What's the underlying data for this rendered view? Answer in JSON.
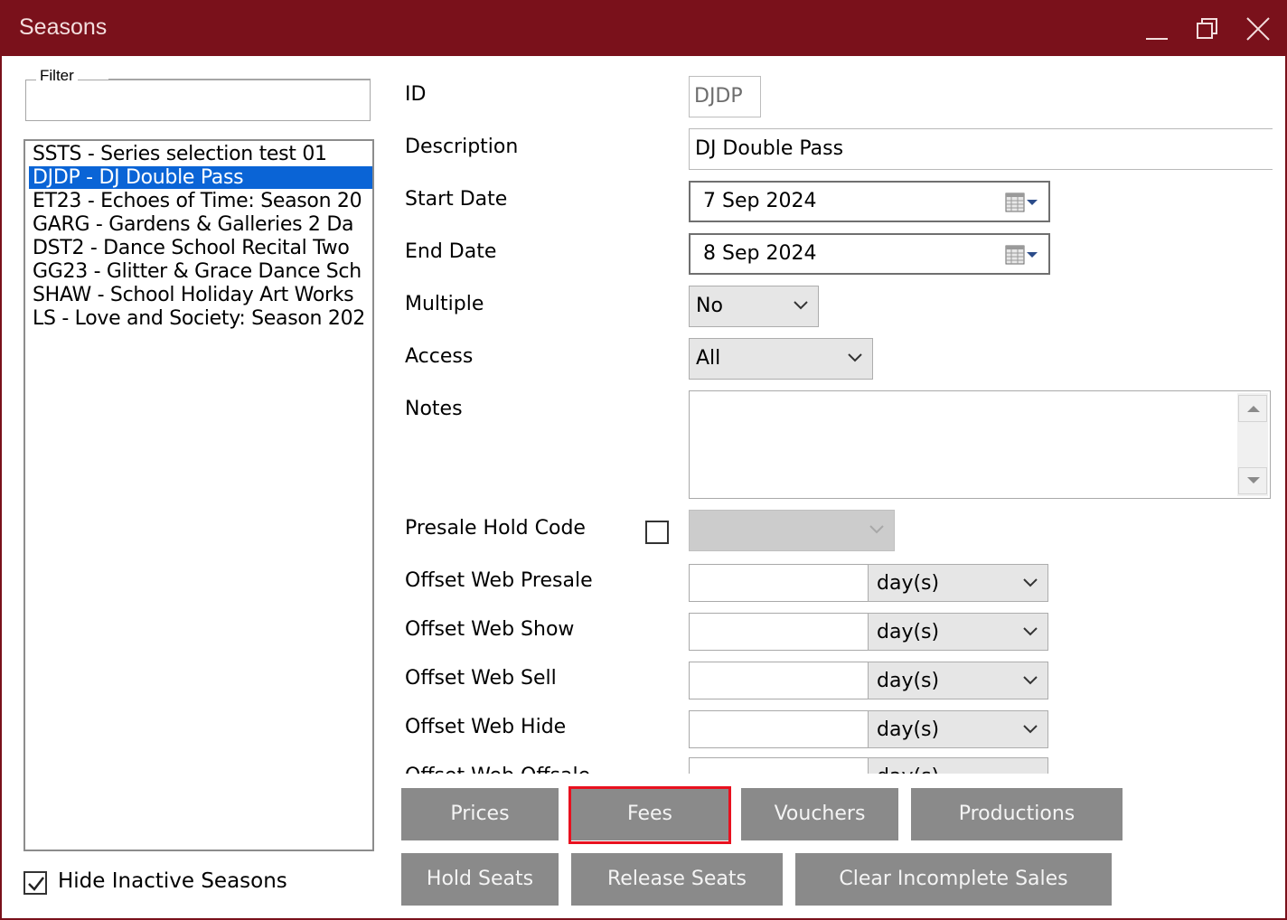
{
  "window": {
    "title": "Seasons"
  },
  "filter": {
    "label": "Filter",
    "value": ""
  },
  "seasons": [
    "SSTS - Series selection test 01",
    "DJDP - DJ Double Pass",
    "ET23 - Echoes of Time: Season 20",
    "GARG - Gardens & Galleries 2 Da",
    "DST2 - Dance School Recital Two",
    "GG23 - Glitter & Grace Dance Sch",
    "SHAW - School Holiday Art Works",
    "LS - Love and Society: Season 202"
  ],
  "selected_season": "DJDP - DJ Double Pass",
  "hide_inactive": {
    "label": "Hide Inactive Seasons",
    "checked": true
  },
  "form": {
    "id_label": "ID",
    "id_value": "DJDP",
    "description_label": "Description",
    "description_value": "DJ Double Pass",
    "start_label": "Start Date",
    "start_value": "7  Sep  2024",
    "end_label": "End Date",
    "end_value": "8  Sep  2024",
    "multiple_label": "Multiple",
    "multiple_value": "No",
    "access_label": "Access",
    "access_value": "All",
    "notes_label": "Notes",
    "notes_value": "",
    "presale_label": "Presale Hold Code",
    "presale_checked": false,
    "offsets": [
      {
        "label": "Offset Web Presale",
        "value": "",
        "unit": "day(s)"
      },
      {
        "label": "Offset Web Show",
        "value": "",
        "unit": "day(s)"
      },
      {
        "label": "Offset Web Sell",
        "value": "",
        "unit": "day(s)"
      },
      {
        "label": "Offset Web Hide",
        "value": "",
        "unit": "day(s)"
      },
      {
        "label": "Offset Web Offsale",
        "value": "",
        "unit": "day(s)"
      }
    ]
  },
  "buttons": {
    "prices": "Prices",
    "fees": "Fees",
    "vouchers": "Vouchers",
    "productions": "Productions",
    "hold_seats": "Hold Seats",
    "release_seats": "Release Seats",
    "clear_incomplete": "Clear Incomplete Sales"
  },
  "colors": {
    "titlebar": "#7a111b",
    "selection": "#0a64d6",
    "button": "#8a8a8a",
    "highlight": "#e8111f"
  }
}
